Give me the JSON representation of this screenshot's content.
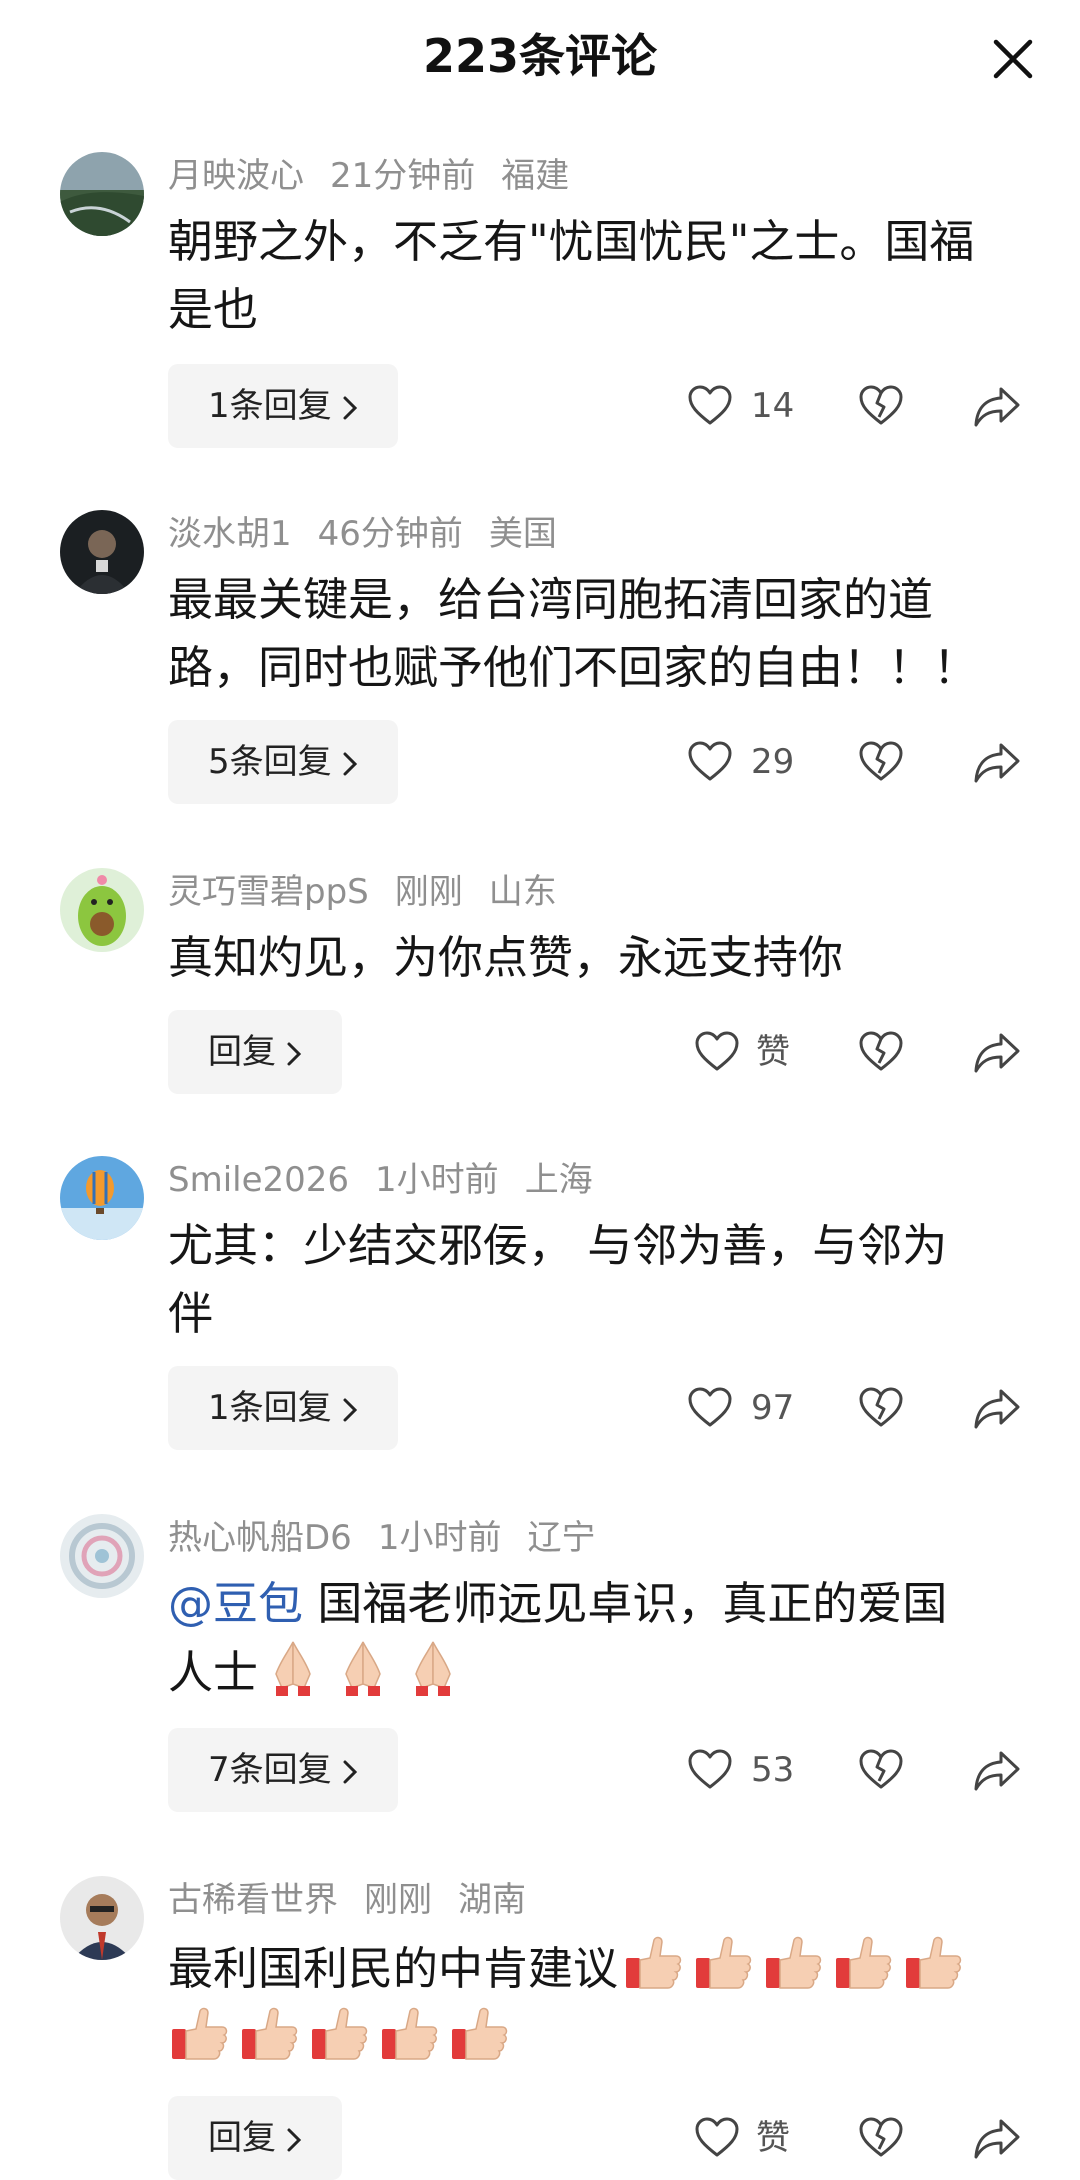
{
  "header": {
    "title": "223条评论"
  },
  "comments": [
    {
      "username": "月映波心",
      "time": "21分钟前",
      "location": "福建",
      "text_line1": "朝野之外，不乏有\"忧国忧民\"之士。国福",
      "text_line2": "是也",
      "reply_label": "1条回复",
      "likes": "14"
    },
    {
      "username": "淡水胡1",
      "time": "46分钟前",
      "location": "美国",
      "text_line1": "最最关键是，给台湾同胞拓清回家的道",
      "text_line2": "路，同时也赋予他们不回家的自由！！！",
      "reply_label": "5条回复",
      "likes": "29"
    },
    {
      "username": "灵巧雪碧ppS",
      "time": "刚刚",
      "location": "山东",
      "text_line1": "真知灼见，为你点赞，永远支持你",
      "reply_label": "回复",
      "likes": "赞"
    },
    {
      "username": "Smile2026",
      "time": "1小时前",
      "location": "上海",
      "text_line1": "尤其：少结交邪佞， 与邻为善，与邻为",
      "text_line2": "伴",
      "reply_label": "1条回复",
      "likes": "97"
    },
    {
      "username": "热心帆船D6",
      "time": "1小时前",
      "location": "辽宁",
      "mention": "@豆包",
      "text_line1": " 国福老师远见卓识，真正的爱国",
      "text_line2": "人士",
      "emoji": "pray-emoji",
      "reply_label": "7条回复",
      "likes": "53"
    },
    {
      "username": "古稀看世界",
      "time": "刚刚",
      "location": "湖南",
      "text_line1": "最利国利民的中肯建议",
      "emoji": "thumbs-up-emoji",
      "reply_label": "回复",
      "likes": "赞"
    }
  ],
  "colors": {
    "meta_text": "#8f8f8f",
    "mention": "#2f5fb1",
    "reply_bg": "#f4f4f4"
  },
  "icons": [
    "close-icon",
    "heart-icon",
    "broken-heart-icon",
    "share-icon",
    "chevron-right-icon"
  ]
}
